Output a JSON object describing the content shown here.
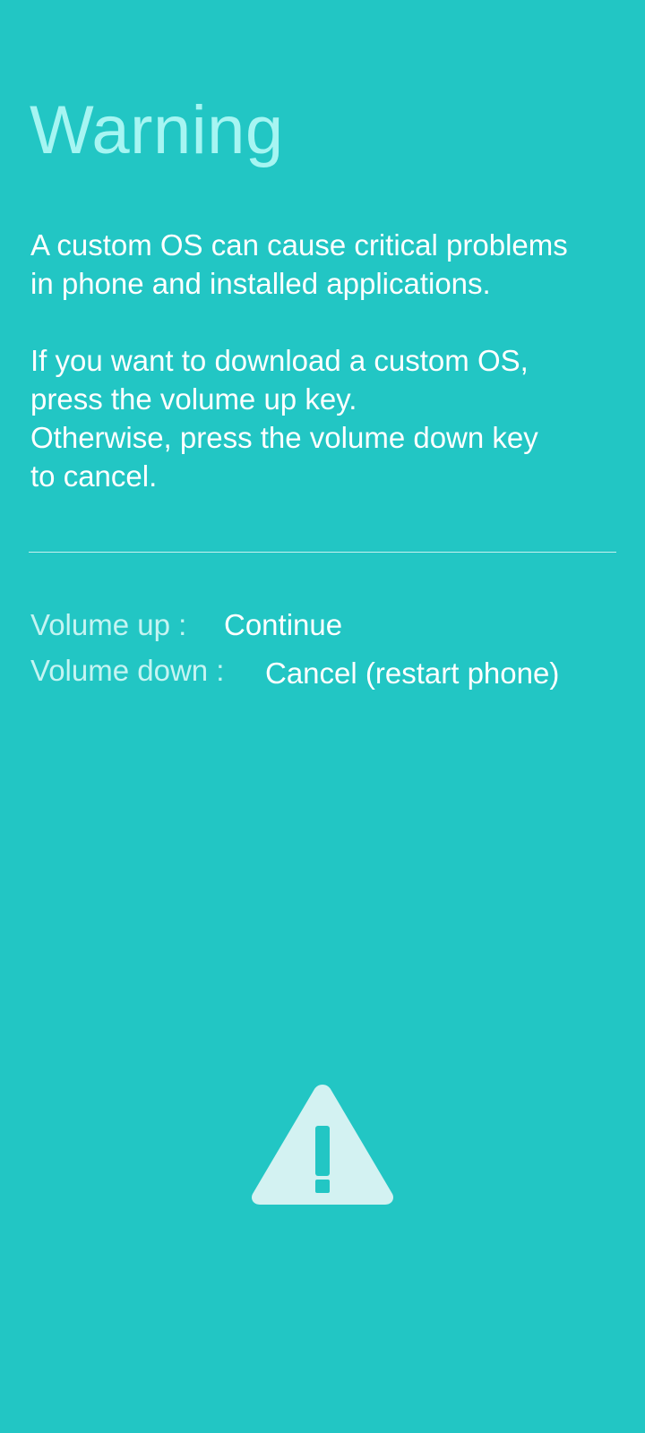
{
  "screen": {
    "title": "Warning",
    "message": {
      "line1": "A custom OS can cause critical problems",
      "line2": "in phone and installed applications.",
      "line3": "If you want to download a custom OS,",
      "line4": "press the volume up key.",
      "line5": "Otherwise, press the volume down key",
      "line6": "to cancel."
    },
    "options": [
      {
        "key": "Volume up :",
        "action": "Continue"
      },
      {
        "key": "Volume down :",
        "action": "Cancel (restart phone)"
      }
    ]
  },
  "colors": {
    "background": "#22C6C4",
    "title": "#A6F5F2",
    "text": "#FFFFFF",
    "key_label": "#C5F4F2",
    "icon_fill": "#D3F2F2"
  },
  "icons": {
    "warning": "warning-triangle-icon"
  }
}
